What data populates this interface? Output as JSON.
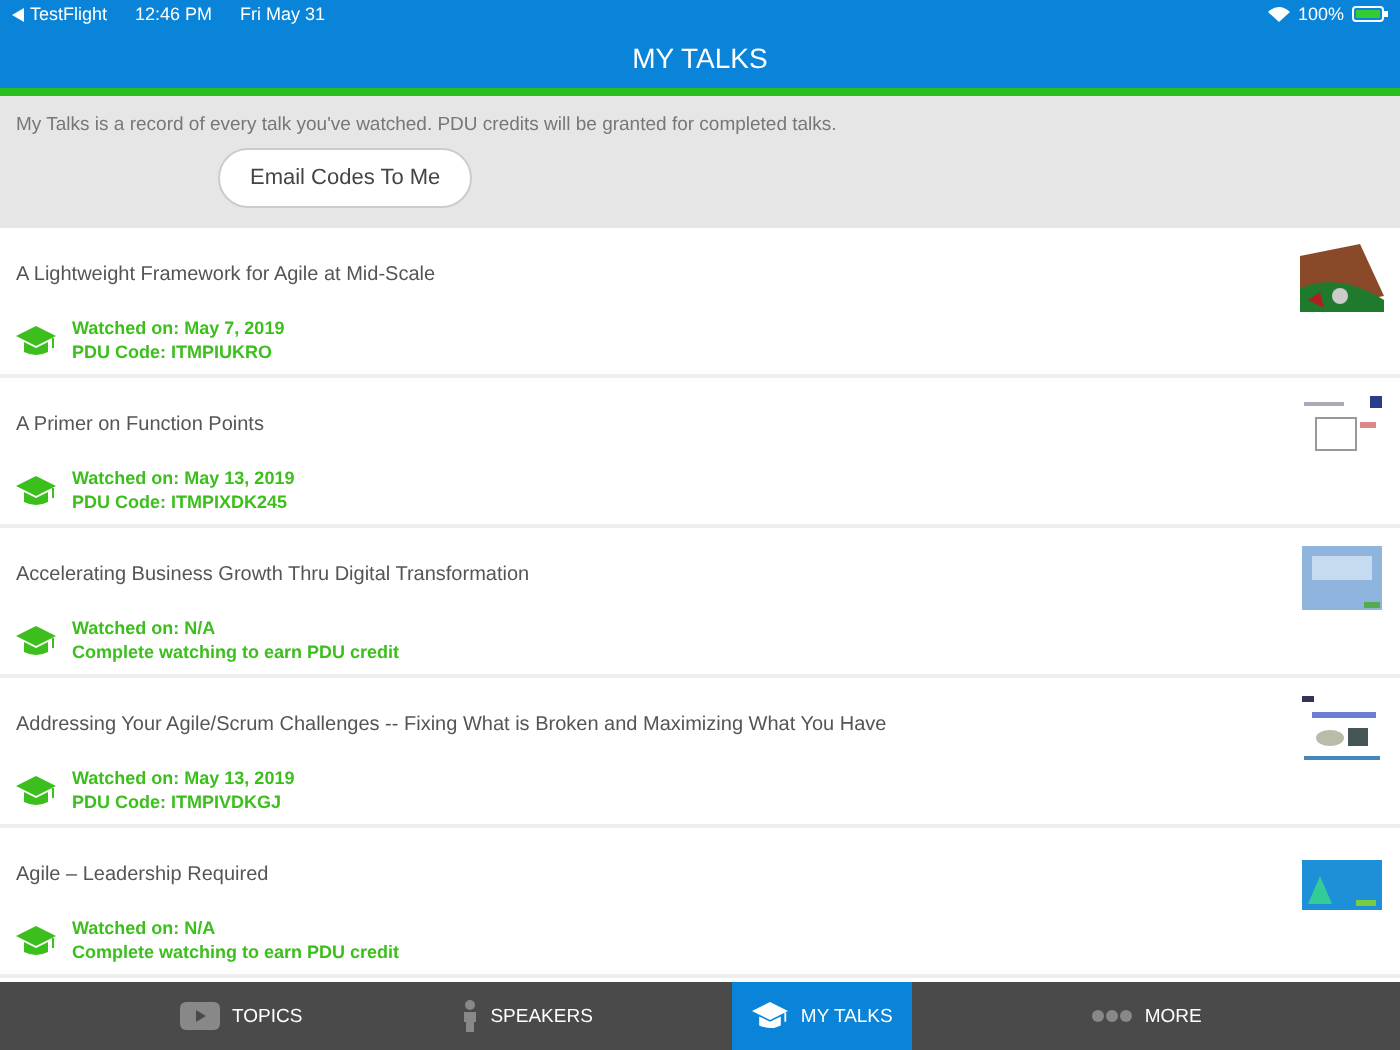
{
  "status_bar": {
    "back_app": "TestFlight",
    "time": "12:46 PM",
    "date": "Fri May 31",
    "battery": "100%"
  },
  "header": {
    "title": "MY TALKS"
  },
  "intro": {
    "text": "My Talks is a record of every talk you've watched. PDU credits will be granted for completed talks.",
    "button": "Email Codes To Me"
  },
  "talks": [
    {
      "title": "A Lightweight Framework for Agile at Mid-Scale",
      "watched": "Watched on: May 7, 2019",
      "detail": "PDU Code: ITMPIUKRO"
    },
    {
      "title": "A Primer on Function Points",
      "watched": "Watched on: May 13, 2019",
      "detail": "PDU Code: ITMPIXDK245"
    },
    {
      "title": "Accelerating Business Growth Thru Digital Transformation",
      "watched": "Watched on: N/A",
      "detail": "Complete watching to earn PDU credit"
    },
    {
      "title": "Addressing Your Agile/Scrum Challenges -- Fixing What is Broken and Maximizing What You Have",
      "watched": "Watched on: May 13, 2019",
      "detail": "PDU Code: ITMPIVDKGJ"
    },
    {
      "title": "Agile – Leadership Required",
      "watched": "Watched on: N/A",
      "detail": "Complete watching to earn PDU credit"
    }
  ],
  "tab_bar": [
    {
      "label": "TOPICS",
      "selected": false
    },
    {
      "label": "SPEAKERS",
      "selected": false
    },
    {
      "label": "MY TALKS",
      "selected": true
    },
    {
      "label": "MORE",
      "selected": false
    }
  ]
}
